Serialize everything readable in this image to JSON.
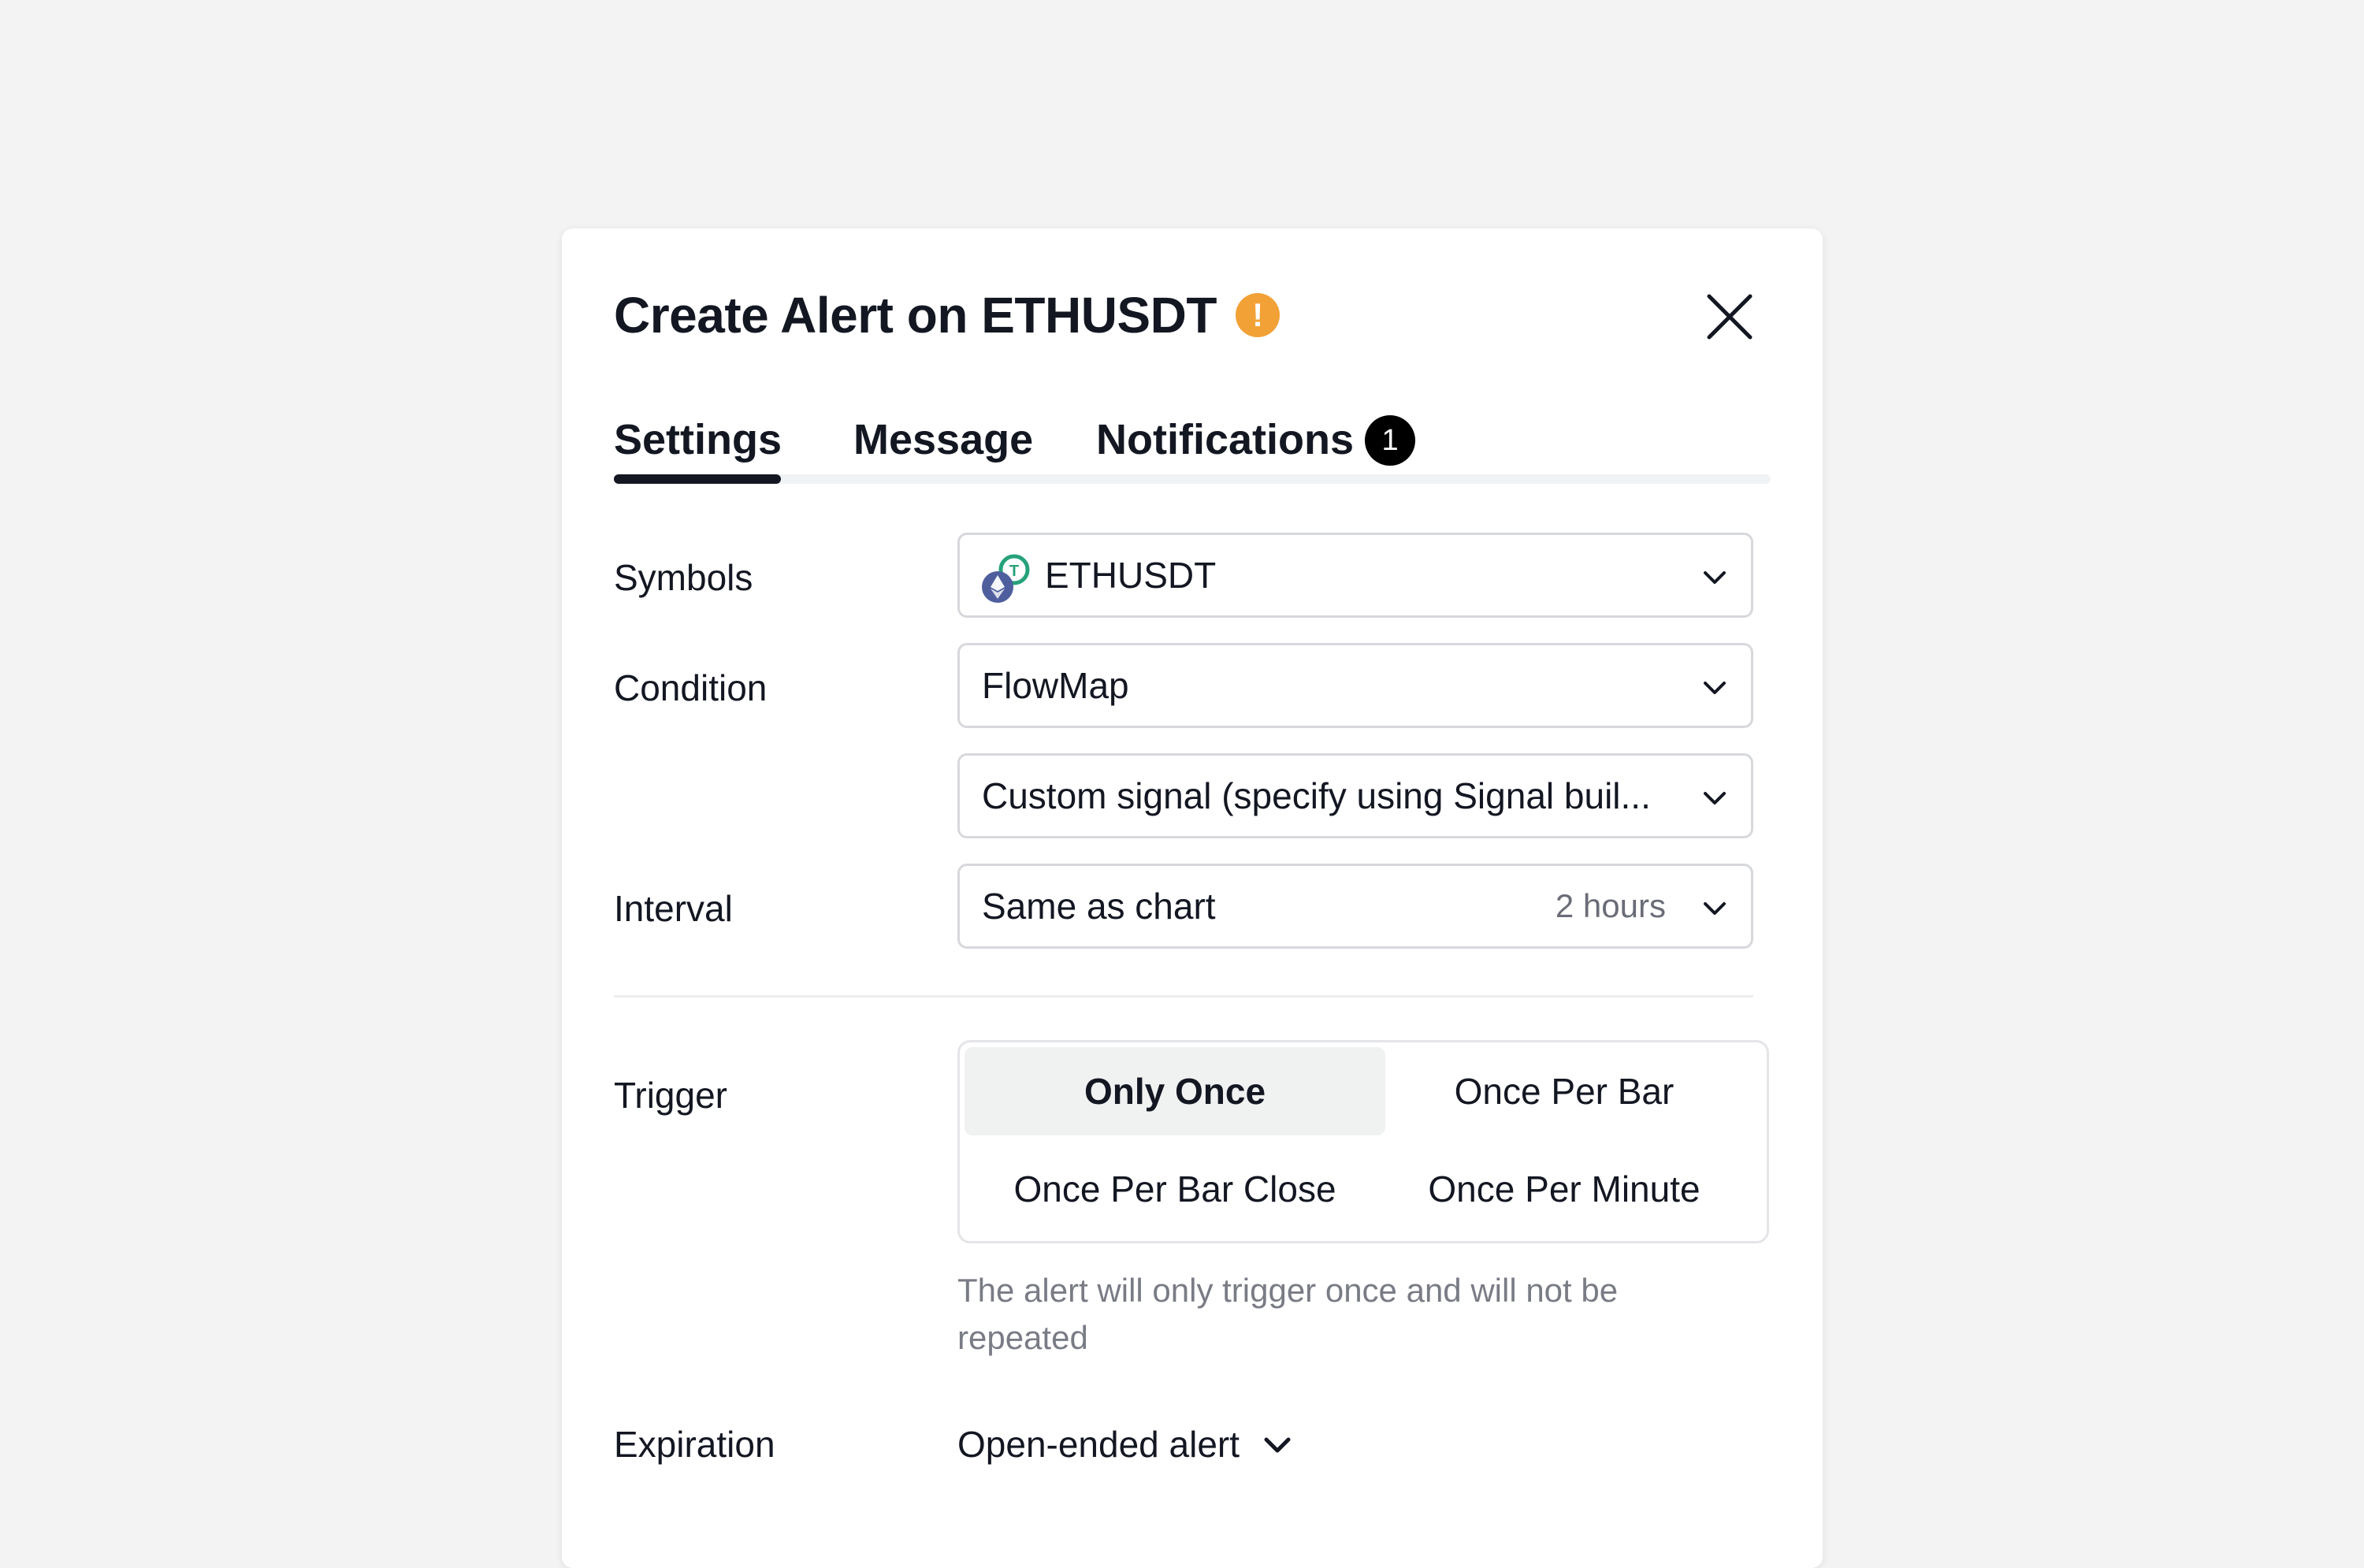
{
  "dialog": {
    "title": "Create Alert on ETHUSDT",
    "warning_icon": "exclamation-circle-icon",
    "warning_symbol": "!",
    "close_icon": "close-icon"
  },
  "tabs": [
    {
      "label": "Settings",
      "active": true
    },
    {
      "label": "Message",
      "active": false
    },
    {
      "label": "Notifications",
      "active": false,
      "badge": "1"
    }
  ],
  "form": {
    "symbols": {
      "label": "Symbols",
      "value": "ETHUSDT",
      "icon": "eth-usdt-coin-icon"
    },
    "condition": {
      "label": "Condition",
      "value": "FlowMap",
      "signal_value": "Custom signal (specify using Signal buil..."
    },
    "interval": {
      "label": "Interval",
      "value": "Same as chart",
      "hint": "2 hours"
    },
    "trigger": {
      "label": "Trigger",
      "options": [
        "Only Once",
        "Once Per Bar",
        "Once Per Bar Close",
        "Once Per Minute"
      ],
      "selected": "Only Once",
      "help": "The alert will only trigger once and will not be repeated"
    },
    "expiration": {
      "label": "Expiration",
      "value": "Open-ended alert"
    }
  },
  "colors": {
    "background": "#f2f3f2",
    "warning": "#f2a137",
    "text": "#131722",
    "muted": "#797c85",
    "eth": "#627eea",
    "usdt": "#26a17b"
  }
}
